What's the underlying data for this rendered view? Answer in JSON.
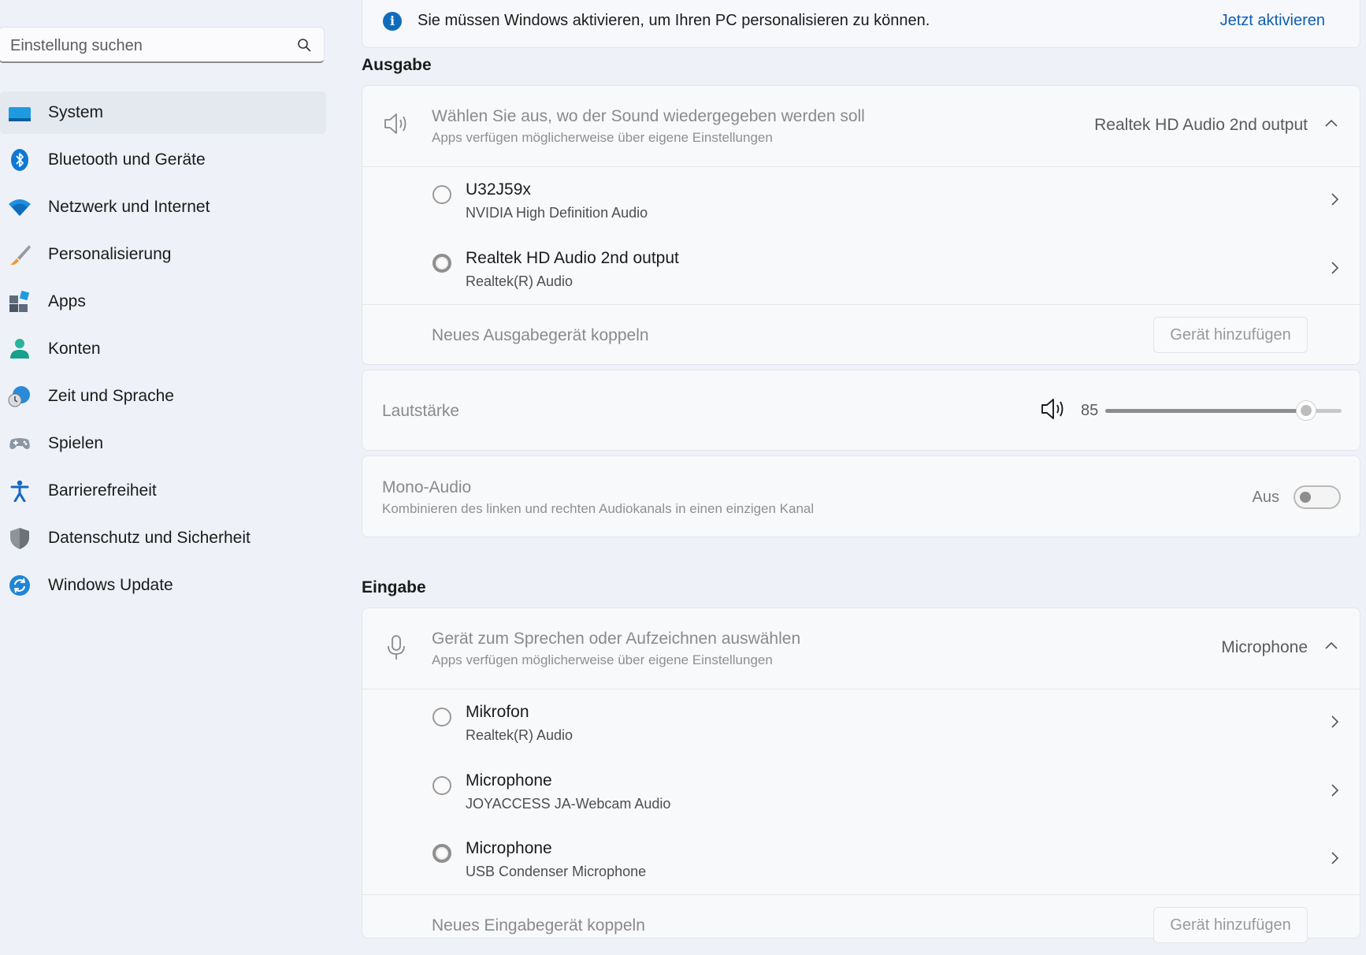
{
  "search": {
    "placeholder": "Einstellung suchen"
  },
  "sidebar": {
    "items": [
      {
        "label": "System",
        "icon": "system-icon",
        "active": true
      },
      {
        "label": "Bluetooth und Geräte",
        "icon": "bluetooth-icon"
      },
      {
        "label": "Netzwerk und Internet",
        "icon": "wifi-icon"
      },
      {
        "label": "Personalisierung",
        "icon": "brush-icon"
      },
      {
        "label": "Apps",
        "icon": "apps-icon"
      },
      {
        "label": "Konten",
        "icon": "account-icon"
      },
      {
        "label": "Zeit und Sprache",
        "icon": "time-language-icon"
      },
      {
        "label": "Spielen",
        "icon": "gamepad-icon"
      },
      {
        "label": "Barrierefreiheit",
        "icon": "accessibility-icon"
      },
      {
        "label": "Datenschutz und Sicherheit",
        "icon": "shield-icon"
      },
      {
        "label": "Windows Update",
        "icon": "update-icon"
      }
    ]
  },
  "banner": {
    "text": "Sie müssen Windows aktivieren, um Ihren PC personalisieren zu können.",
    "link": "Jetzt aktivieren"
  },
  "output": {
    "section_title": "Ausgabe",
    "select_title": "Wählen Sie aus, wo der Sound wiedergegeben werden soll",
    "select_subtitle": "Apps verfügen möglicherweise über eigene Einstellungen",
    "selected_device": "Realtek HD Audio 2nd output",
    "devices": [
      {
        "name": "U32J59x",
        "driver": "NVIDIA High Definition Audio",
        "selected": false
      },
      {
        "name": "Realtek HD Audio 2nd output",
        "driver": "Realtek(R) Audio",
        "selected": true
      }
    ],
    "pair_label": "Neues Ausgabegerät koppeln",
    "pair_button": "Gerät hinzufügen",
    "volume_label": "Lautstärke",
    "volume_value": "85",
    "volume_level": 0.85,
    "mono_title": "Mono-Audio",
    "mono_subtitle": "Kombinieren des linken und rechten Audiokanals in einen einzigen Kanal",
    "mono_state": "Aus"
  },
  "input": {
    "section_title": "Eingabe",
    "select_title": "Gerät zum Sprechen oder Aufzeichnen auswählen",
    "select_subtitle": "Apps verfügen möglicherweise über eigene Einstellungen",
    "selected_device": "Microphone",
    "devices": [
      {
        "name": "Mikrofon",
        "driver": "Realtek(R) Audio",
        "selected": false
      },
      {
        "name": "Microphone",
        "driver": "JOYACCESS JA-Webcam Audio",
        "selected": false
      },
      {
        "name": "Microphone",
        "driver": "USB Condenser Microphone",
        "selected": true
      }
    ],
    "pair_label": "Neues Eingabegerät koppeln",
    "pair_button": "Gerät hinzufügen"
  },
  "colors": {
    "accent": "#0f6cbd",
    "link": "#0f5fb0",
    "active_nav": "#e4e8ef"
  }
}
